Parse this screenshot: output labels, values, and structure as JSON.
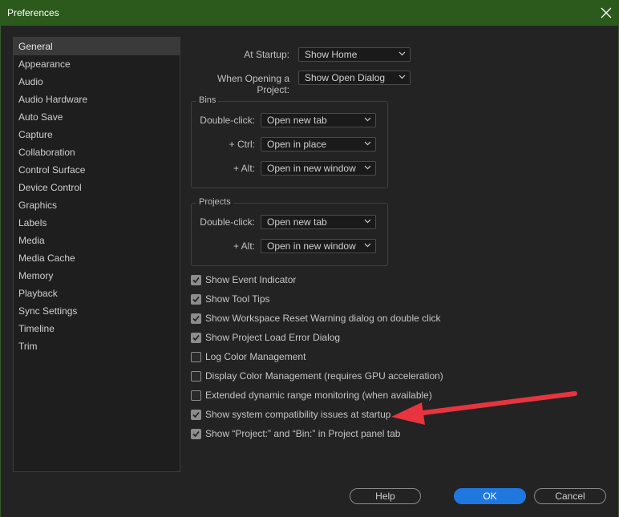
{
  "window": {
    "title": "Preferences"
  },
  "sidebar": {
    "items": [
      {
        "label": "General",
        "selected": true
      },
      {
        "label": "Appearance"
      },
      {
        "label": "Audio"
      },
      {
        "label": "Audio Hardware"
      },
      {
        "label": "Auto Save"
      },
      {
        "label": "Capture"
      },
      {
        "label": "Collaboration"
      },
      {
        "label": "Control Surface"
      },
      {
        "label": "Device Control"
      },
      {
        "label": "Graphics"
      },
      {
        "label": "Labels"
      },
      {
        "label": "Media"
      },
      {
        "label": "Media Cache"
      },
      {
        "label": "Memory"
      },
      {
        "label": "Playback"
      },
      {
        "label": "Sync Settings"
      },
      {
        "label": "Timeline"
      },
      {
        "label": "Trim"
      }
    ]
  },
  "general": {
    "at_startup": {
      "label": "At Startup:",
      "value": "Show Home"
    },
    "when_opening": {
      "label": "When Opening a Project:",
      "value": "Show Open Dialog"
    },
    "bins": {
      "title": "Bins",
      "double_click": {
        "label": "Double-click:",
        "value": "Open new tab"
      },
      "ctrl": {
        "label": "+ Ctrl:",
        "value": "Open in place"
      },
      "alt": {
        "label": "+ Alt:",
        "value": "Open in new window"
      }
    },
    "projects": {
      "title": "Projects",
      "double_click": {
        "label": "Double-click:",
        "value": "Open new tab"
      },
      "alt": {
        "label": "+ Alt:",
        "value": "Open in new window"
      }
    },
    "checkboxes": [
      {
        "label": "Show Event Indicator",
        "checked": true
      },
      {
        "label": "Show Tool Tips",
        "checked": true
      },
      {
        "label": "Show Workspace Reset Warning dialog on double click",
        "checked": true
      },
      {
        "label": "Show Project Load Error Dialog",
        "checked": true
      },
      {
        "label": "Log Color Management",
        "checked": false
      },
      {
        "label": "Display Color Management (requires GPU acceleration)",
        "checked": false
      },
      {
        "label": "Extended dynamic range monitoring (when available)",
        "checked": false
      },
      {
        "label": "Show system compatibility issues at startup",
        "checked": true
      },
      {
        "label": "Show “Project:” and “Bin:” in Project panel tab",
        "checked": true
      }
    ]
  },
  "buttons": {
    "help": "Help",
    "ok": "OK",
    "cancel": "Cancel"
  },
  "colors": {
    "titlebar": "#2b5a1c",
    "accent": "#1f78e0",
    "annotation_arrow": "#e8343e"
  }
}
